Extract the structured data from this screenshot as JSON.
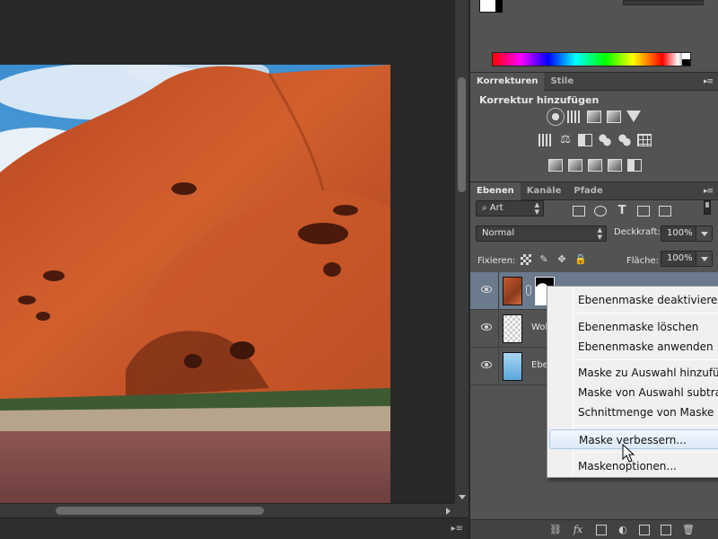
{
  "adjustments_panel": {
    "tabs": [
      "Korrekturen",
      "Stile"
    ],
    "title": "Korrektur hinzufügen",
    "icons_row1": [
      "brightness-icon",
      "levels-icon",
      "curves-icon",
      "exposure-icon",
      "vibrance-icon"
    ],
    "icons_row2": [
      "hue-saturation-icon",
      "color-balance-icon",
      "black-white-icon",
      "photo-filter-icon",
      "channel-mixer-icon",
      "color-lookup-icon"
    ],
    "icons_row3": [
      "invert-icon",
      "posterize-icon",
      "threshold-icon",
      "gradient-map-icon",
      "selective-color-icon"
    ]
  },
  "layers_panel": {
    "tabs": [
      "Ebenen",
      "Kanäle",
      "Pfade"
    ],
    "filter_kind": "Art",
    "blend_mode": "Normal",
    "opacity_label": "Deckkraft:",
    "opacity_value": "100%",
    "lock_label": "Fixieren:",
    "fill_label": "Fläche:",
    "fill_value": "100%",
    "layers": [
      {
        "name": "",
        "thumb": "rock",
        "has_mask": true,
        "selected": true
      },
      {
        "name": "Wol",
        "thumb": "transparent",
        "has_mask": false,
        "selected": false
      },
      {
        "name": "Ebe",
        "thumb": "sky",
        "has_mask": false,
        "selected": false
      }
    ],
    "footer_icons": [
      "link-icon",
      "fx-icon",
      "add-mask-icon",
      "adjustment-layer-icon",
      "group-folder-icon",
      "new-layer-icon",
      "trash-icon"
    ]
  },
  "context_menu": {
    "items": [
      {
        "label": "Ebenenmaske deaktivieren",
        "hover": false
      },
      {
        "label": "Ebenenmaske löschen",
        "hover": false
      },
      {
        "label": "Ebenenmaske anwenden",
        "hover": false
      },
      {
        "label": "Maske zu Auswahl hinzufügen",
        "hover": false
      },
      {
        "label": "Maske von Auswahl subtrahieren",
        "hover": false
      },
      {
        "label": "Schnittmenge von Maske und Auswahl",
        "hover": false
      },
      {
        "label": "Maske verbessern...",
        "hover": true
      },
      {
        "label": "Maskenoptionen...",
        "hover": false
      }
    ]
  },
  "colors": {
    "panel_bg": "#535353",
    "tab_bar": "#424242",
    "selected_layer": "#6b7a8c",
    "menu_bg": "#f0f0f0",
    "rock": "#c65a2e",
    "sky": "#4a9bd6"
  }
}
